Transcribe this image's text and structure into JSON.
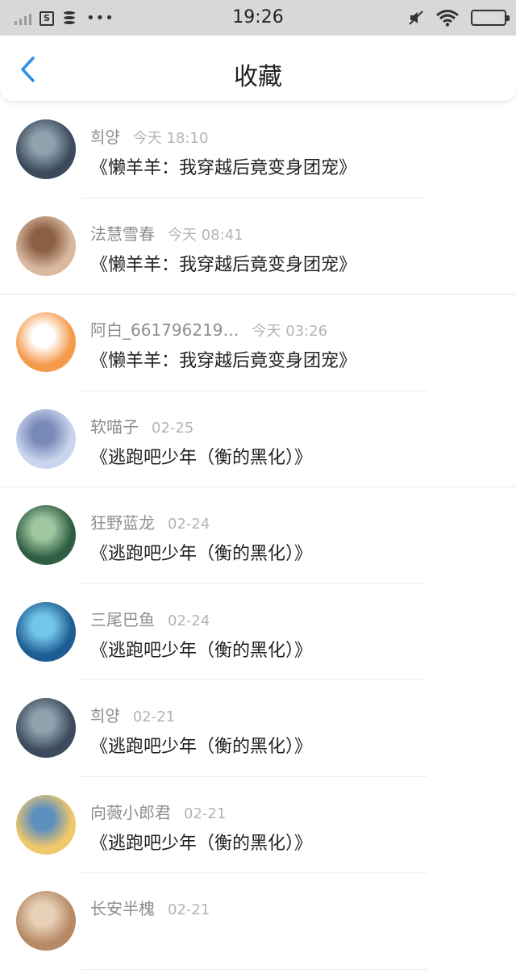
{
  "status_bar": {
    "time": "19:26",
    "icons": [
      "signal-icon",
      "sim-icon",
      "database-icon",
      "more-dots-icon",
      "mute-icon",
      "wifi-icon",
      "battery-icon"
    ]
  },
  "nav": {
    "title": "收藏",
    "back_icon": "chevron-left-icon",
    "accent": "#2f8fe8"
  },
  "items": [
    {
      "name": "희양",
      "time": "今天 18:10",
      "title": "《懒羊羊：我穿越后竟变身团宠》",
      "avatar_colors": [
        "#3b4a5c",
        "#8fa2ad"
      ]
    },
    {
      "name": "法慧雪春",
      "time": "今天 08:41",
      "title": "《懒羊羊：我穿越后竟变身团宠》",
      "avatar_colors": [
        "#d9b9a0",
        "#8a5f43"
      ]
    },
    {
      "name": "阿白_661796219…",
      "time": "今天 03:26",
      "title": "《懒羊羊：我穿越后竟变身团宠》",
      "avatar_colors": [
        "#f59a4b",
        "#ffffff"
      ]
    },
    {
      "name": "软喵子",
      "time": "02-25",
      "title": "《逃跑吧少年（衡的黑化）》",
      "avatar_colors": [
        "#c9d6ee",
        "#7a8ab8"
      ]
    },
    {
      "name": "狂野蓝龙",
      "time": "02-24",
      "title": "《逃跑吧少年（衡的黑化）》",
      "avatar_colors": [
        "#2f5e43",
        "#9fc7a0"
      ]
    },
    {
      "name": "三尾巴鱼",
      "time": "02-24",
      "title": "《逃跑吧少年（衡的黑化）》",
      "avatar_colors": [
        "#1e5c93",
        "#73c6e8"
      ]
    },
    {
      "name": "희양",
      "time": "02-21",
      "title": "《逃跑吧少年（衡的黑化）》",
      "avatar_colors": [
        "#3b4a5c",
        "#8fa2ad"
      ]
    },
    {
      "name": "向薇小郎君",
      "time": "02-21",
      "title": "《逃跑吧少年（衡的黑化）》",
      "avatar_colors": [
        "#f0c86a",
        "#5d8fbf"
      ]
    },
    {
      "name": "长安半槐",
      "time": "02-21",
      "title": "",
      "avatar_colors": [
        "#b68a66",
        "#e8d1b7"
      ]
    }
  ]
}
